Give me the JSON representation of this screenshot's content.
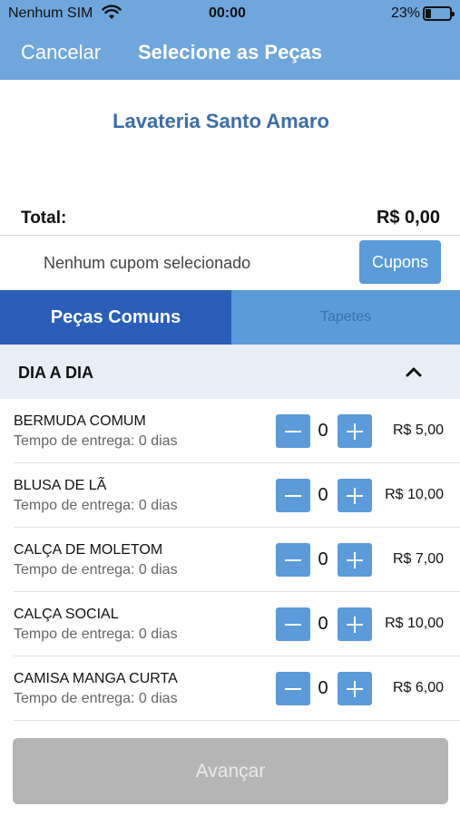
{
  "status_bar": {
    "carrier": "Nenhum SIM",
    "time": "00:00",
    "battery_percent": "23%"
  },
  "nav": {
    "cancel_label": "Cancelar",
    "title": "Selecione as Peças"
  },
  "store": {
    "name": "Lavateria Santo Amaro"
  },
  "summary": {
    "total_label": "Total:",
    "total_value": "R$ 0,00"
  },
  "coupon": {
    "status_text": "Nenhum cupom selecionado",
    "button_label": "Cupons"
  },
  "tabs": [
    {
      "label": "Peças Comuns",
      "active": true
    },
    {
      "label": "Tapetes",
      "active": false
    }
  ],
  "section": {
    "title": "DIA A DIA",
    "expanded": true
  },
  "items": [
    {
      "name": "BERMUDA COMUM",
      "delivery": "Tempo de entrega: 0 dias",
      "quantity": "0",
      "price": "R$ 5,00"
    },
    {
      "name": "BLUSA DE LÃ",
      "delivery": "Tempo de entrega: 0 dias",
      "quantity": "0",
      "price": "R$ 10,00"
    },
    {
      "name": "CALÇA DE MOLETOM",
      "delivery": "Tempo de entrega: 0 dias",
      "quantity": "0",
      "price": "R$ 7,00"
    },
    {
      "name": "CALÇA SOCIAL",
      "delivery": "Tempo de entrega: 0 dias",
      "quantity": "0",
      "price": "R$ 10,00"
    },
    {
      "name": "CAMISA MANGA CURTA",
      "delivery": "Tempo de entrega: 0 dias",
      "quantity": "0",
      "price": "R$ 6,00"
    }
  ],
  "footer": {
    "advance_label": "Avançar",
    "advance_enabled": false
  },
  "colors": {
    "nav_bar": "#6fa6dc",
    "tab_active": "#2a5eb8",
    "tab_inactive": "#5b9bd9",
    "button_blue": "#5b9bd9",
    "store_name": "#3b6ea8",
    "section_bg": "#e8eef5",
    "disabled_button": "#b5b5b5"
  },
  "icons": {
    "wifi": "wifi-icon",
    "battery": "battery-icon",
    "chevron": "chevron-up-icon",
    "minus": "minus-icon",
    "plus": "plus-icon"
  }
}
